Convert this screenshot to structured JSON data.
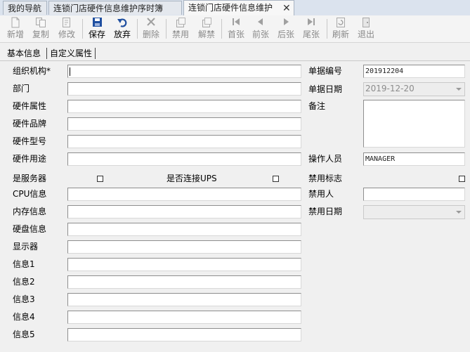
{
  "tabs": [
    {
      "label": "我的导航"
    },
    {
      "label": "连锁门店硬件信息维护序时簿"
    },
    {
      "label": "连锁门店硬件信息维护",
      "close": "✕"
    }
  ],
  "toolbar": [
    {
      "label": "新增",
      "icon": "new-icon"
    },
    {
      "label": "复制",
      "icon": "copy-icon"
    },
    {
      "label": "修改",
      "icon": "edit-icon"
    },
    {
      "label": "保存",
      "icon": "save-icon"
    },
    {
      "label": "放弃",
      "icon": "undo-icon"
    },
    {
      "label": "删除",
      "icon": "delete-icon"
    },
    {
      "label": "禁用",
      "icon": "disable-icon"
    },
    {
      "label": "解禁",
      "icon": "enable-icon"
    },
    {
      "label": "首张",
      "icon": "first-icon"
    },
    {
      "label": "前张",
      "icon": "prev-icon"
    },
    {
      "label": "后张",
      "icon": "next-icon"
    },
    {
      "label": "尾张",
      "icon": "last-icon"
    },
    {
      "label": "刷新",
      "icon": "refresh-icon"
    },
    {
      "label": "退出",
      "icon": "exit-icon"
    }
  ],
  "subtabs": [
    {
      "label": "基本信息"
    },
    {
      "label": "自定义属性"
    }
  ],
  "left_fields": [
    {
      "label": "组织机构*",
      "value": ""
    },
    {
      "label": "部门",
      "value": ""
    },
    {
      "label": "硬件属性",
      "value": ""
    },
    {
      "label": "硬件品牌",
      "value": ""
    },
    {
      "label": "硬件型号",
      "value": ""
    },
    {
      "label": "硬件用途",
      "value": ""
    }
  ],
  "checks": {
    "server_label": "是服务器",
    "ups_label": "是否连接UPS",
    "disabled_flag_label": "禁用标志"
  },
  "lower_fields": [
    {
      "label": "CPU信息",
      "value": ""
    },
    {
      "label": "内存信息",
      "value": ""
    },
    {
      "label": "硬盘信息",
      "value": ""
    },
    {
      "label": "显示器",
      "value": ""
    },
    {
      "label": "信息1",
      "value": ""
    },
    {
      "label": "信息2",
      "value": ""
    },
    {
      "label": "信息3",
      "value": ""
    },
    {
      "label": "信息4",
      "value": ""
    },
    {
      "label": "信息5",
      "value": ""
    }
  ],
  "right": {
    "bill_no_label": "单据编号",
    "bill_no": "201912204",
    "bill_date_label": "单据日期",
    "bill_date": "2019-12-20",
    "remark_label": "备注",
    "operator_label": "操作人员",
    "operator": "MANAGER",
    "disabled_by_label": "禁用人",
    "disabled_by": "",
    "disabled_date_label": "禁用日期",
    "disabled_date": ""
  },
  "colors": {
    "tab_bar": "#dbe3ee",
    "save_icon": "#1f4fa0",
    "undo_icon": "#1f4fa0",
    "disabled_text": "#8a8a8a"
  }
}
